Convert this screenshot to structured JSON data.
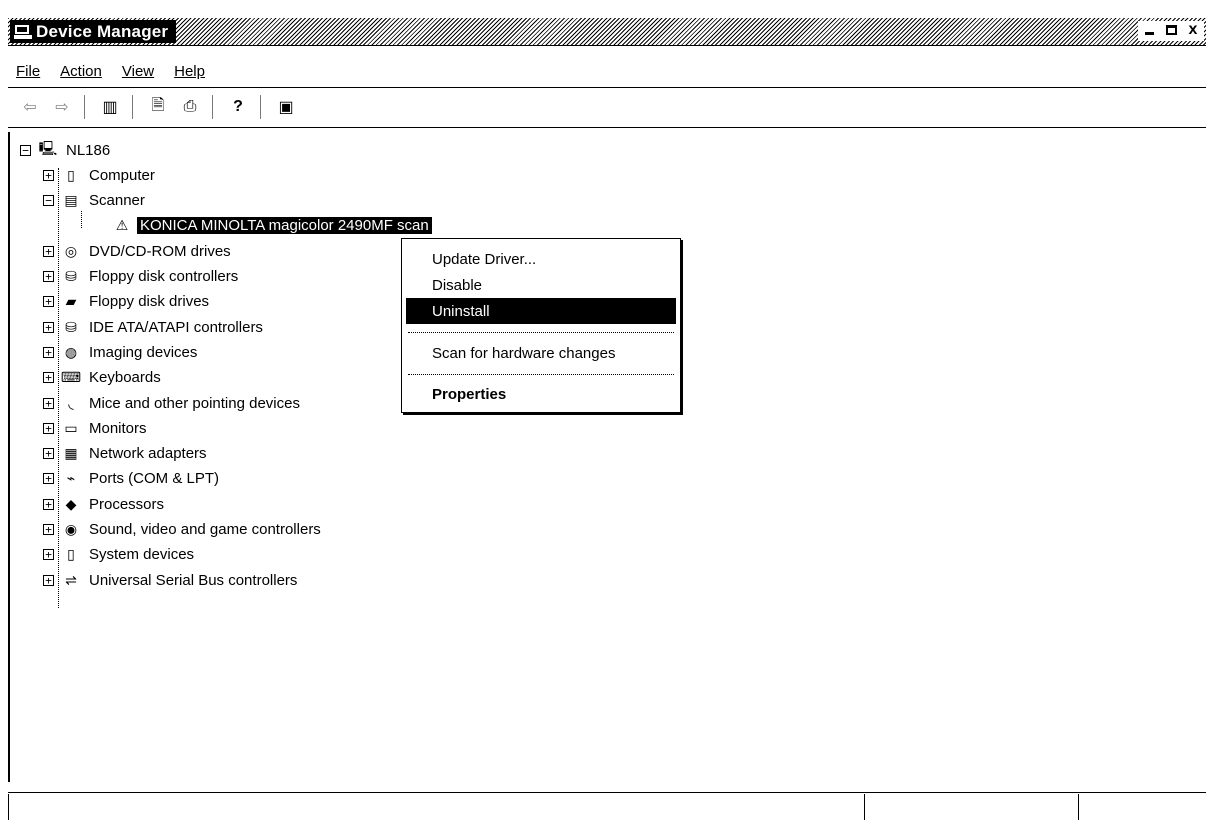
{
  "window": {
    "title": "Device Manager"
  },
  "window_controls": {
    "minimize": "_",
    "maximize": "□",
    "close": "x"
  },
  "menu": [
    {
      "label": "File"
    },
    {
      "label": "Action"
    },
    {
      "label": "View"
    },
    {
      "label": "Help"
    }
  ],
  "toolbar": [
    {
      "icon": "back-arrow-icon",
      "glyph": "⇦"
    },
    {
      "icon": "forward-arrow-icon",
      "glyph": "⇨"
    },
    {
      "icon": "show-hide-console-tree-icon",
      "glyph": "▥"
    },
    {
      "icon": "properties-icon",
      "glyph": "🗎"
    },
    {
      "icon": "print-icon",
      "glyph": "⎙"
    },
    {
      "icon": "help-icon",
      "glyph": "?"
    },
    {
      "icon": "scan-hardware-icon",
      "glyph": "▣"
    }
  ],
  "tree": {
    "root": {
      "label": "NL186",
      "icon": "computer-network-icon"
    },
    "categories": [
      {
        "label": "Computer",
        "icon": "computer-icon"
      },
      {
        "label": "Scanner",
        "icon": "scanner-icon",
        "expanded": true,
        "children": [
          {
            "label": "KONICA MINOLTA magicolor 2490MF scan",
            "icon": "device-warning-icon",
            "selected": true
          }
        ]
      },
      {
        "label": "DVD/CD-ROM drives",
        "icon": "dvd-drive-icon"
      },
      {
        "label": "Floppy disk controllers",
        "icon": "disk-controller-icon"
      },
      {
        "label": "Floppy disk drives",
        "icon": "floppy-drive-icon"
      },
      {
        "label": "IDE ATA/ATAPI controllers",
        "icon": "ide-controller-icon"
      },
      {
        "label": "Imaging devices",
        "icon": "camera-icon"
      },
      {
        "label": "Keyboards",
        "icon": "keyboard-icon"
      },
      {
        "label": "Mice and other pointing devices",
        "icon": "mouse-icon"
      },
      {
        "label": "Monitors",
        "icon": "monitor-icon"
      },
      {
        "label": "Network adapters",
        "icon": "network-adapter-icon"
      },
      {
        "label": "Ports (COM & LPT)",
        "icon": "port-icon"
      },
      {
        "label": "Processors",
        "icon": "processor-icon"
      },
      {
        "label": "Sound, video and game controllers",
        "icon": "sound-icon"
      },
      {
        "label": "System devices",
        "icon": "system-device-icon"
      },
      {
        "label": "Universal Serial Bus controllers",
        "icon": "usb-icon"
      }
    ]
  },
  "context_menu": {
    "items": [
      {
        "label": "Update Driver..."
      },
      {
        "label": "Disable"
      },
      {
        "label": "Uninstall",
        "highlighted": true
      },
      {
        "label": "Scan for hardware changes"
      },
      {
        "label": "Properties",
        "bold": true
      }
    ]
  }
}
